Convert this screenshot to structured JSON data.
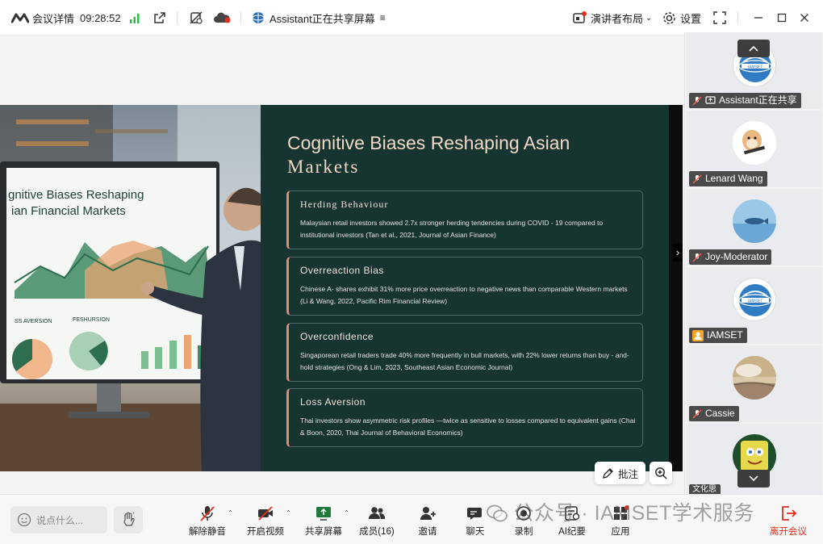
{
  "topbar": {
    "meeting_details": "会议详情",
    "time": "09:28:52",
    "sharing_status": "Assistant正在共享屏幕",
    "presenter_layout": "演讲者布局",
    "settings": "设置"
  },
  "slide": {
    "title_line1": "Cognitive Biases Reshaping Asian",
    "title_line2": "Markets",
    "monitor_title_1": "gnitive Biases Reshaping",
    "monitor_title_2": "ian Financial Markets",
    "monitor_label_1": "SS AVERSION",
    "monitor_label_2": "FESHURSION",
    "cards": [
      {
        "heading": "Herding Behaviour",
        "text": "Malaysian retail investors showed 2.7x stronger herding tendencies during COVID    - 19 compared to institutional investors (Tan et al., 2021, Journal of Asian Finance)"
      },
      {
        "heading": "Overreaction Bias",
        "text": "Chinese A- shares exhibit 31% more price overreaction to negative news than comparable Western markets (Li & Wang, 2022, Pacific Rim Financial Review)"
      },
      {
        "heading": "Overconfidence",
        "text": "Singaporean retail traders trade 40% more frequently in bull markets, with 22% lower returns than buy - and- hold strategies (Ong & Lim, 2023, Southeast Asian Economic Journal)"
      },
      {
        "heading": "Loss Aversion",
        "text": "Thai investors show asymmetric risk profiles    —twice as sensitive to losses compared to equivalent gains (Chai & Boon, 2020, Thai Journal of Behavioral Economics)"
      }
    ]
  },
  "stage": {
    "annotate_label": "批注"
  },
  "participants": [
    {
      "name": "Assistant正在共享",
      "avatar": "iamset-globe-logo",
      "muted": true,
      "sharing": true
    },
    {
      "name": "Lenard Wang",
      "avatar": "cartoon-hamster",
      "muted": true
    },
    {
      "name": "Joy-Moderator",
      "avatar": "fish-in-water",
      "muted": true
    },
    {
      "name": "IAMSET",
      "avatar": "iamset-globe-logo",
      "muted": false,
      "host": true
    },
    {
      "name": "Cassie",
      "avatar": "cloudy-sky",
      "muted": true
    },
    {
      "name": "文化思",
      "avatar": "sponge-cartoon",
      "muted": false
    }
  ],
  "toolbar": {
    "chat_placeholder": "说点什么...",
    "unmute": "解除静音",
    "start_video": "开启视频",
    "share_screen": "共享屏幕",
    "members": "成员(16)",
    "invite": "邀请",
    "chat": "聊天",
    "record": "录制",
    "ai_minutes": "AI纪要",
    "apps": "应用",
    "leave": "离开会议"
  },
  "watermark": "公众号 · IAMSET学术服务",
  "colors": {
    "slide_panel": "#163430",
    "slide_title": "#f0d8c6",
    "card_accent": "#d98f73",
    "signal_green": "#2bbf4a",
    "leave_red": "#e0301e",
    "host_badge": "#f5a623"
  }
}
